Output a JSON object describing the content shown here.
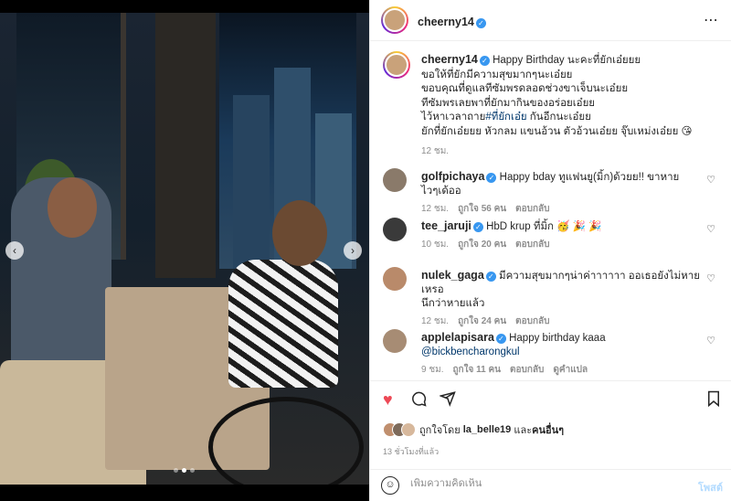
{
  "post": {
    "author": "cheerny14",
    "caption_lines": [
      "Happy Birthday นะคะที่ยักเอ๋ยยย",
      "ขอให้ที่ยักมีความสุขมากๆนะเอ๋ยย",
      "ขอบคุณที่ดูแลทีซัมพรดลอดช่วงขาเจ็บนะเอ๋ยย",
      "ทีซัมพรเลยพาที่ยักมากินของอร่อยเอ๋ยย",
      "ไว้หาเวลาถาย",
      "ยักที่ยักเอ๋ยยย หัวกลม แขนอ้วน ตัวอ้วนเอ๋ยย จุ๊บเหม่งเอ๋ยย 😘"
    ],
    "hashtag": "#ที่ยักเอ๋ย",
    "hashtag_suffix": " กันอีกนะเอ๋ยย",
    "caption_time": "12 ชม.",
    "likes_text_prefix": "ถูกใจโดย",
    "likes_user": "la_belle19",
    "likes_and": "และ",
    "likes_others": "คนอื่นๆ",
    "posted_ago": "13 ชั่วโมงที่แล้ว"
  },
  "comments": [
    {
      "user": "golfpichaya",
      "text": "Happy bday ทูแฟนยู(มิ้ก)ด้วยย!! ขาหายไวๆเด้ออ",
      "time": "12 ชม.",
      "likes": "ถูกใจ 56 คน",
      "reply": "ตอบกลับ",
      "avatar_color": "#8a7a6a"
    },
    {
      "user": "tee_jaruji",
      "text": "HbD krup ที่มิ้ก 🥳 🎉 🎉",
      "time": "10 ชม.",
      "likes": "ถูกใจ 20 คน",
      "reply": "ตอบกลับ",
      "avatar_color": "#3a3a3a"
    },
    {
      "user": "nulek_gaga",
      "text": "มีความสุขมากๆน่าค่าาาาาา ออเธอยังไม่หายเหรอ",
      "text2": "นึกว่าหายแล้ว",
      "time": "12 ชม.",
      "likes": "ถูกใจ 24 คน",
      "reply": "ตอบกลับ",
      "avatar_color": "#b98a6a"
    },
    {
      "user": "applelapisara",
      "text": "Happy birthday kaaa",
      "mention": "@bickbencharongkul",
      "time": "9 ชม.",
      "likes": "ถูกใจ 11 คน",
      "reply": "ตอบกลับ",
      "translate": "ดูคำแปล",
      "avatar_color": "#a78c74"
    }
  ],
  "composer": {
    "placeholder": "เพิ่มความคิดเห็น",
    "post_label": "โพสต์"
  },
  "icons": {
    "more": "more-horizontal-icon",
    "like": "heart-filled-icon",
    "comment": "comment-icon",
    "share": "share-icon",
    "save": "bookmark-icon",
    "emoji": "emoji-icon"
  },
  "colors": {
    "verified": "#3897f0",
    "like_red": "#ed4956",
    "link": "#00376b",
    "muted": "#8e8e8e",
    "post_disabled": "#b3dbff"
  },
  "carousel": {
    "current_index": 2,
    "total": 3
  }
}
